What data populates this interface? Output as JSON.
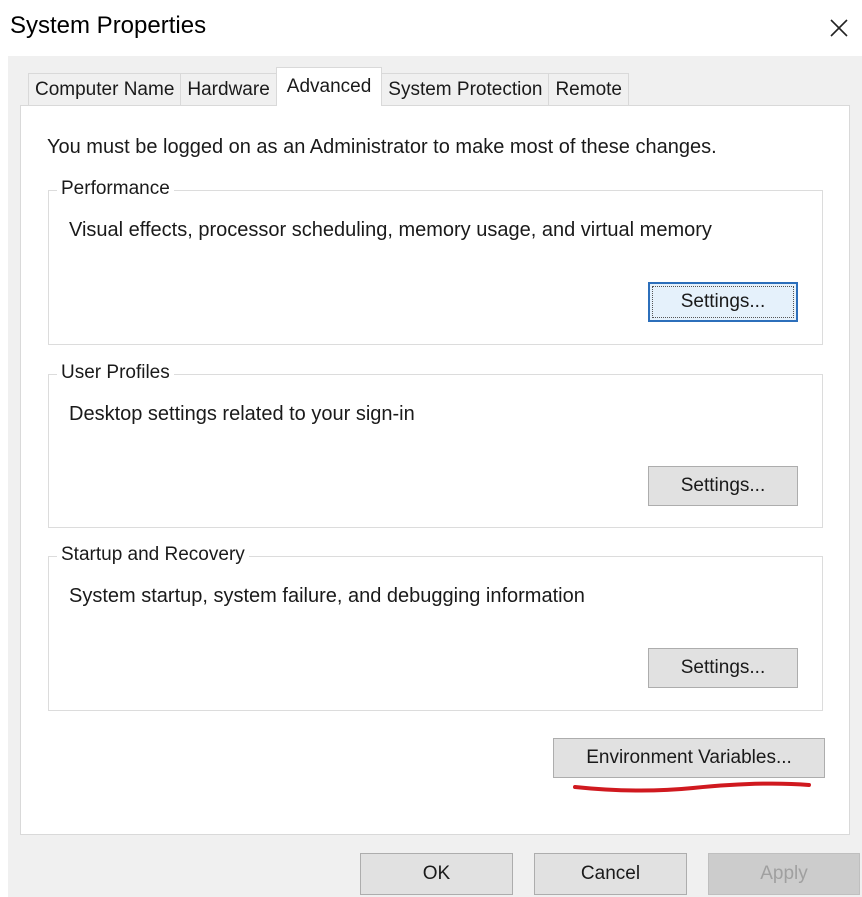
{
  "window": {
    "title": "System Properties"
  },
  "icons": {
    "close": "close-icon"
  },
  "tabs": [
    {
      "label": "Computer Name",
      "active": false
    },
    {
      "label": "Hardware",
      "active": false
    },
    {
      "label": "Advanced",
      "active": true
    },
    {
      "label": "System Protection",
      "active": false
    },
    {
      "label": "Remote",
      "active": false
    }
  ],
  "advanced": {
    "intro": "You must be logged on as an Administrator to make most of these changes.",
    "performance": {
      "label": "Performance",
      "description": "Visual effects, processor scheduling, memory usage, and virtual memory",
      "button": "Settings..."
    },
    "user_profiles": {
      "label": "User Profiles",
      "description": "Desktop settings related to your sign-in",
      "button": "Settings..."
    },
    "startup_recovery": {
      "label": "Startup and Recovery",
      "description": "System startup, system failure, and debugging information",
      "button": "Settings..."
    },
    "env_button": "Environment Variables..."
  },
  "footer": {
    "ok": "OK",
    "cancel": "Cancel",
    "apply": "Apply"
  },
  "colors": {
    "focus_border": "#2c6fbb",
    "annotation_red": "#d0191f"
  }
}
